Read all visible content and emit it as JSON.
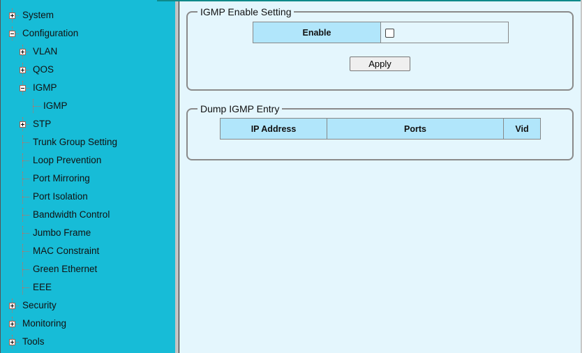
{
  "sidebar": {
    "items": [
      {
        "label": "System",
        "level": 0,
        "toggle": "plus"
      },
      {
        "label": "Configuration",
        "level": 0,
        "toggle": "minus"
      },
      {
        "label": "VLAN",
        "level": 1,
        "toggle": "plus"
      },
      {
        "label": "QOS",
        "level": 1,
        "toggle": "plus"
      },
      {
        "label": "IGMP",
        "level": 1,
        "toggle": "minus"
      },
      {
        "label": "IGMP",
        "level": 2,
        "toggle": "none"
      },
      {
        "label": "STP",
        "level": 1,
        "toggle": "plus"
      },
      {
        "label": "Trunk Group Setting",
        "level": 1,
        "toggle": "none"
      },
      {
        "label": "Loop Prevention",
        "level": 1,
        "toggle": "none"
      },
      {
        "label": "Port Mirroring",
        "level": 1,
        "toggle": "none"
      },
      {
        "label": "Port Isolation",
        "level": 1,
        "toggle": "none"
      },
      {
        "label": "Bandwidth Control",
        "level": 1,
        "toggle": "none"
      },
      {
        "label": "Jumbo Frame",
        "level": 1,
        "toggle": "none"
      },
      {
        "label": "MAC Constraint",
        "level": 1,
        "toggle": "none"
      },
      {
        "label": "Green Ethernet",
        "level": 1,
        "toggle": "none"
      },
      {
        "label": "EEE",
        "level": 1,
        "toggle": "none"
      },
      {
        "label": "Security",
        "level": 0,
        "toggle": "plus"
      },
      {
        "label": "Monitoring",
        "level": 0,
        "toggle": "plus"
      },
      {
        "label": "Tools",
        "level": 0,
        "toggle": "plus"
      }
    ]
  },
  "igmp_enable": {
    "legend": "IGMP Enable Setting",
    "enable_label": "Enable",
    "enabled": false,
    "apply_label": "Apply"
  },
  "dump": {
    "legend": "Dump IGMP Entry",
    "columns": [
      "IP Address",
      "Ports",
      "Vid"
    ],
    "rows": []
  },
  "colors": {
    "sidebar": "#17bcd7",
    "content_bg": "#e4f6fd",
    "header_cell": "#b1e6fb"
  }
}
